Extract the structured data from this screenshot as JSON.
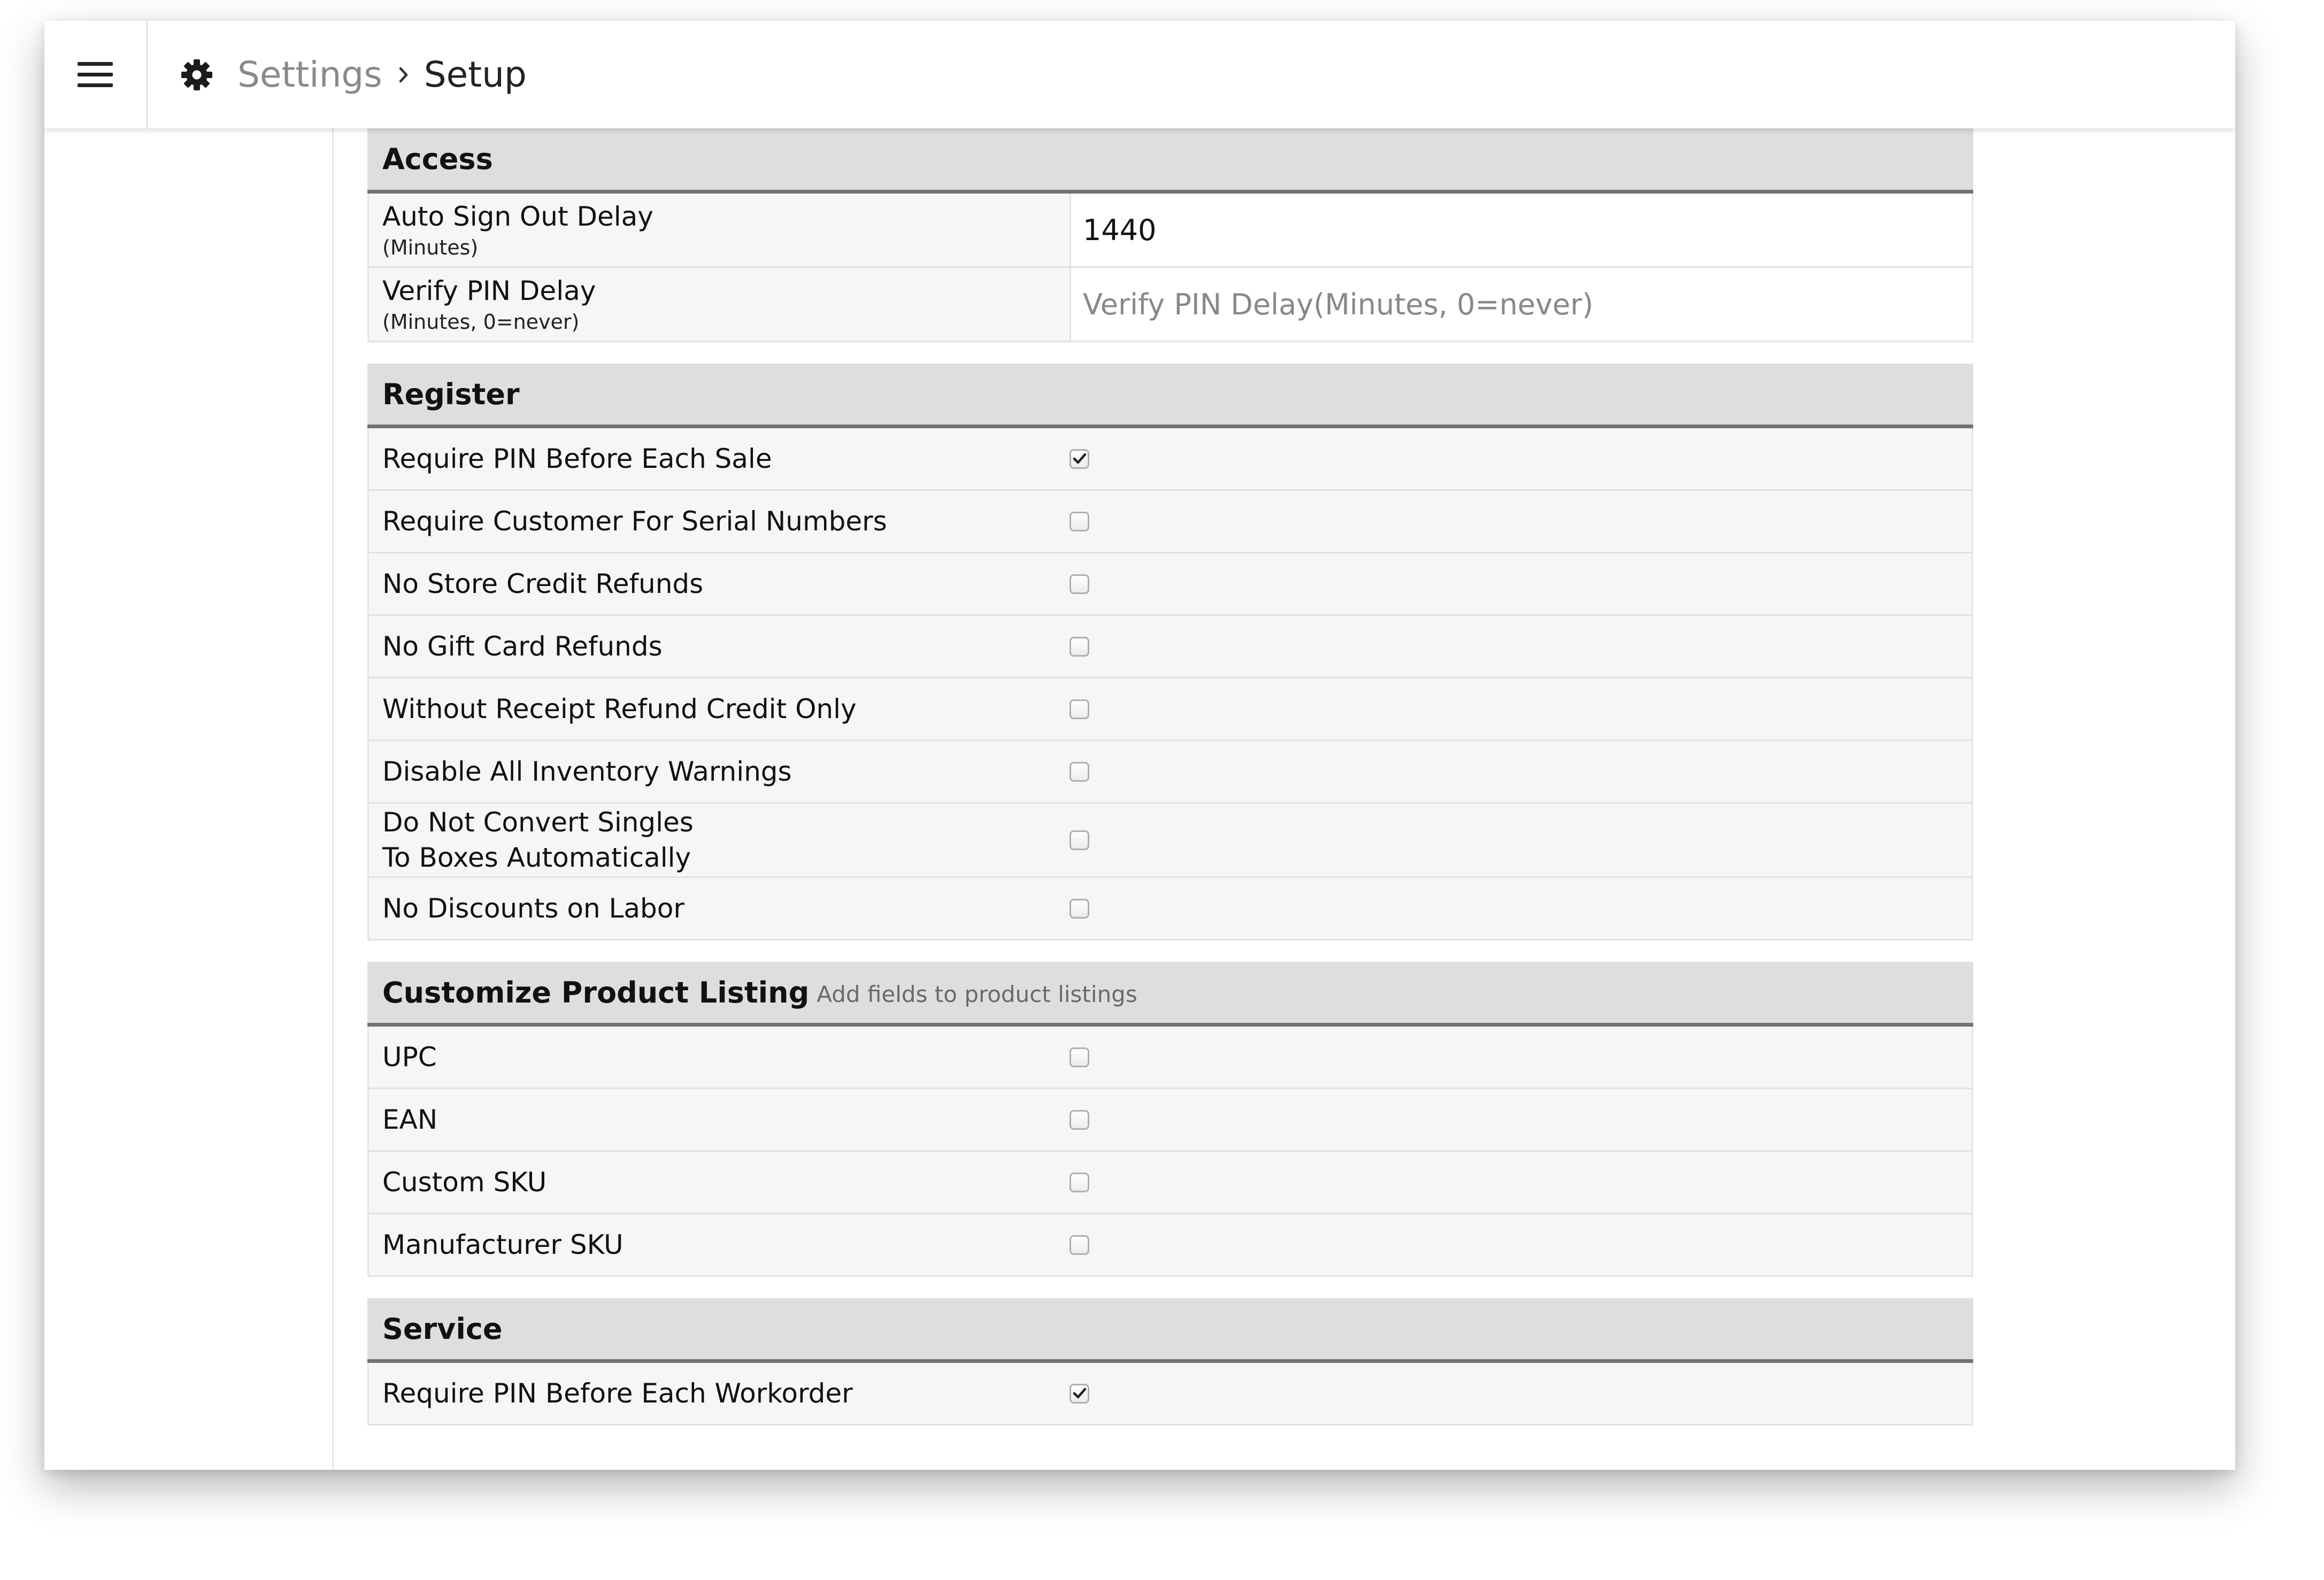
{
  "header": {
    "breadcrumb_parent": "Settings",
    "breadcrumb_current": "Setup"
  },
  "access": {
    "title": "Access",
    "auto_sign_out": {
      "label": "Auto Sign Out Delay",
      "sub": "(Minutes)",
      "value": "1440"
    },
    "verify_pin": {
      "label": "Verify PIN Delay",
      "sub": "(Minutes, 0=never)",
      "value": "",
      "placeholder": "Verify PIN Delay(Minutes, 0=never)"
    }
  },
  "register": {
    "title": "Register",
    "items": [
      {
        "label": "Require PIN Before Each Sale",
        "checked": true
      },
      {
        "label": "Require Customer For Serial Numbers",
        "checked": false
      },
      {
        "label": "No Store Credit Refunds",
        "checked": false
      },
      {
        "label": "No Gift Card Refunds",
        "checked": false
      },
      {
        "label": "Without Receipt Refund Credit Only",
        "checked": false
      },
      {
        "label": "Disable All Inventory Warnings",
        "checked": false
      },
      {
        "label": "Do Not Convert Singles",
        "label2": "To Boxes Automatically",
        "checked": false
      },
      {
        "label": "No Discounts on Labor",
        "checked": false
      }
    ]
  },
  "product_listing": {
    "title": "Customize Product Listing",
    "subtitle": "Add fields to product listings",
    "items": [
      {
        "label": "UPC",
        "checked": false
      },
      {
        "label": "EAN",
        "checked": false
      },
      {
        "label": "Custom SKU",
        "checked": false
      },
      {
        "label": "Manufacturer SKU",
        "checked": false
      }
    ]
  },
  "service": {
    "title": "Service",
    "items": [
      {
        "label": "Require PIN Before Each Workorder",
        "checked": true
      }
    ]
  },
  "icons": {
    "menu": "hamburger-menu-icon",
    "settings": "gear-icon",
    "separator": "chevron-right-icon",
    "check": "checkmark-icon"
  },
  "colors": {
    "section_header_bg": "#dedede",
    "section_header_border": "#727272",
    "row_bg": "#f6f6f6",
    "breadcrumb_parent": "#8a8a8a"
  }
}
